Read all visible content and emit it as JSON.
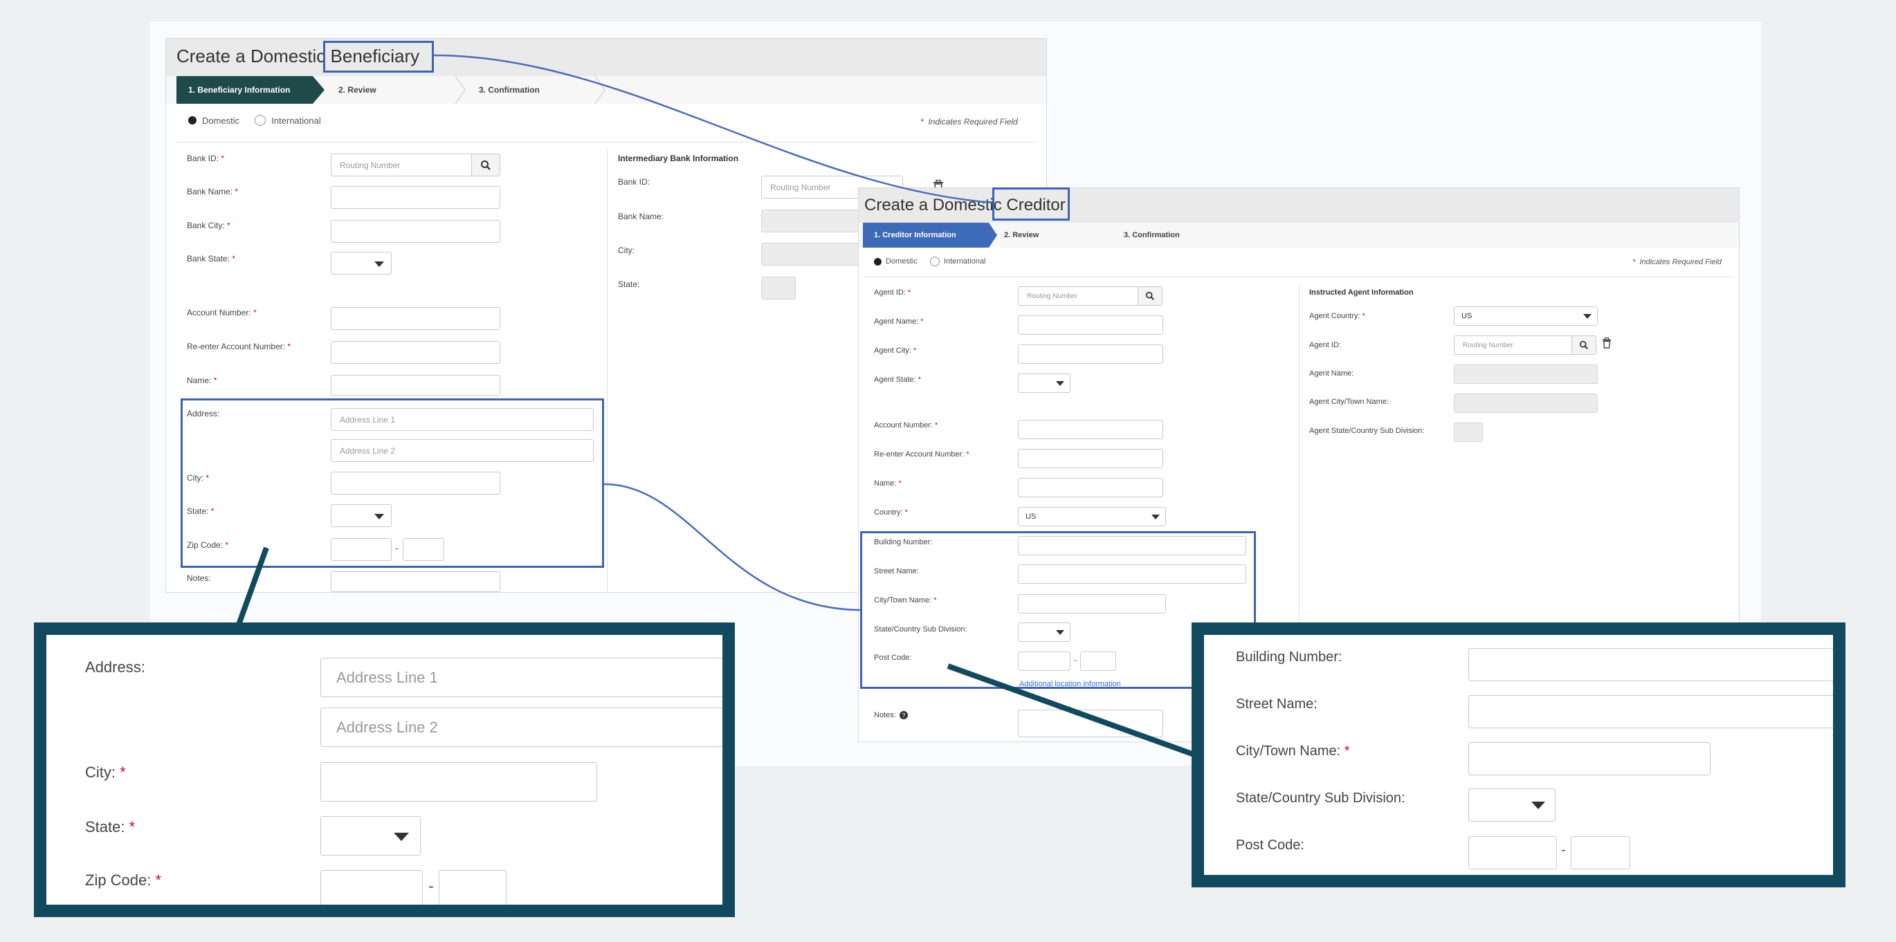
{
  "beneficiary_window": {
    "title": "Create a Domestic Beneficiary",
    "steps": [
      "1. Beneficiary Information",
      "2. Review",
      "3. Confirmation"
    ],
    "radio_domestic": "Domestic",
    "radio_international": "International",
    "required_note": "Indicates Required Field",
    "fields": {
      "bank_id": "Bank ID:",
      "bank_name": "Bank Name:",
      "bank_city": "Bank City:",
      "bank_state": "Bank State:",
      "account_number": "Account Number:",
      "reenter_account": "Re-enter Account Number:",
      "name": "Name:",
      "address": "Address:",
      "city": "City:",
      "state": "State:",
      "zip_code": "Zip Code:",
      "notes": "Notes:"
    },
    "placeholders": {
      "routing_number": "Routing Number",
      "address_line_1": "Address Line 1",
      "address_line_2": "Address Line 2"
    },
    "intermediary": {
      "title": "Intermediary Bank Information",
      "bank_id": "Bank ID:",
      "bank_name": "Bank Name:",
      "city": "City:",
      "state": "State:",
      "routing_placeholder": "Routing Number"
    }
  },
  "creditor_window": {
    "title": "Create a Domestic Creditor",
    "steps": [
      "1. Creditor Information",
      "2. Review",
      "3. Confirmation"
    ],
    "radio_domestic": "Domestic",
    "radio_international": "International",
    "required_note": "Indicates Required Field",
    "fields": {
      "agent_id": "Agent ID:",
      "agent_name": "Agent Name:",
      "agent_city": "Agent City:",
      "agent_state": "Agent State:",
      "account_number": "Account Number:",
      "reenter_account": "Re-enter Account Number:",
      "name": "Name:",
      "country": "Country:",
      "building_number": "Building Number:",
      "street_name": "Street Name:",
      "city_town_name": "City/Town Name:",
      "state_sub_division": "State/Country Sub Division:",
      "post_code": "Post Code:",
      "notes": "Notes:"
    },
    "country_value": "US",
    "routing_placeholder": "Routing Number",
    "additional_location_link": "Additional location information",
    "instructed_agent": {
      "title": "Instructed Agent Information",
      "agent_country": "Agent Country:",
      "agent_country_value": "US",
      "agent_id": "Agent ID:",
      "routing_placeholder": "Routing Number",
      "agent_name": "Agent Name:",
      "agent_city_town_name": "Agent City/Town Name:",
      "agent_state_sub_division": "Agent State/Country Sub Division:"
    }
  },
  "zoom_left": {
    "address": "Address:",
    "address_line_1": "Address Line 1",
    "address_line_2": "Address Line 2",
    "city": "City:",
    "state": "State:",
    "zip_code": "Zip Code:"
  },
  "zoom_right": {
    "building_number": "Building Number:",
    "street_name": "Street Name:",
    "city_town_name": "City/Town Name:",
    "state_sub_division": "State/Country Sub Division:",
    "post_code": "Post Code:"
  },
  "colors": {
    "step_active_beneficiary": "#1e4b4a",
    "step_active_creditor": "#3e6bb8",
    "highlight_blue": "#3e63b3",
    "zoom_frame": "#114a5e",
    "required_star": "#c8102e",
    "link": "#3b6fd8"
  },
  "icons": {
    "search": "magnifier-icon",
    "delete": "trash-icon",
    "dropdown": "caret-down-icon",
    "help": "question-circle-icon"
  }
}
